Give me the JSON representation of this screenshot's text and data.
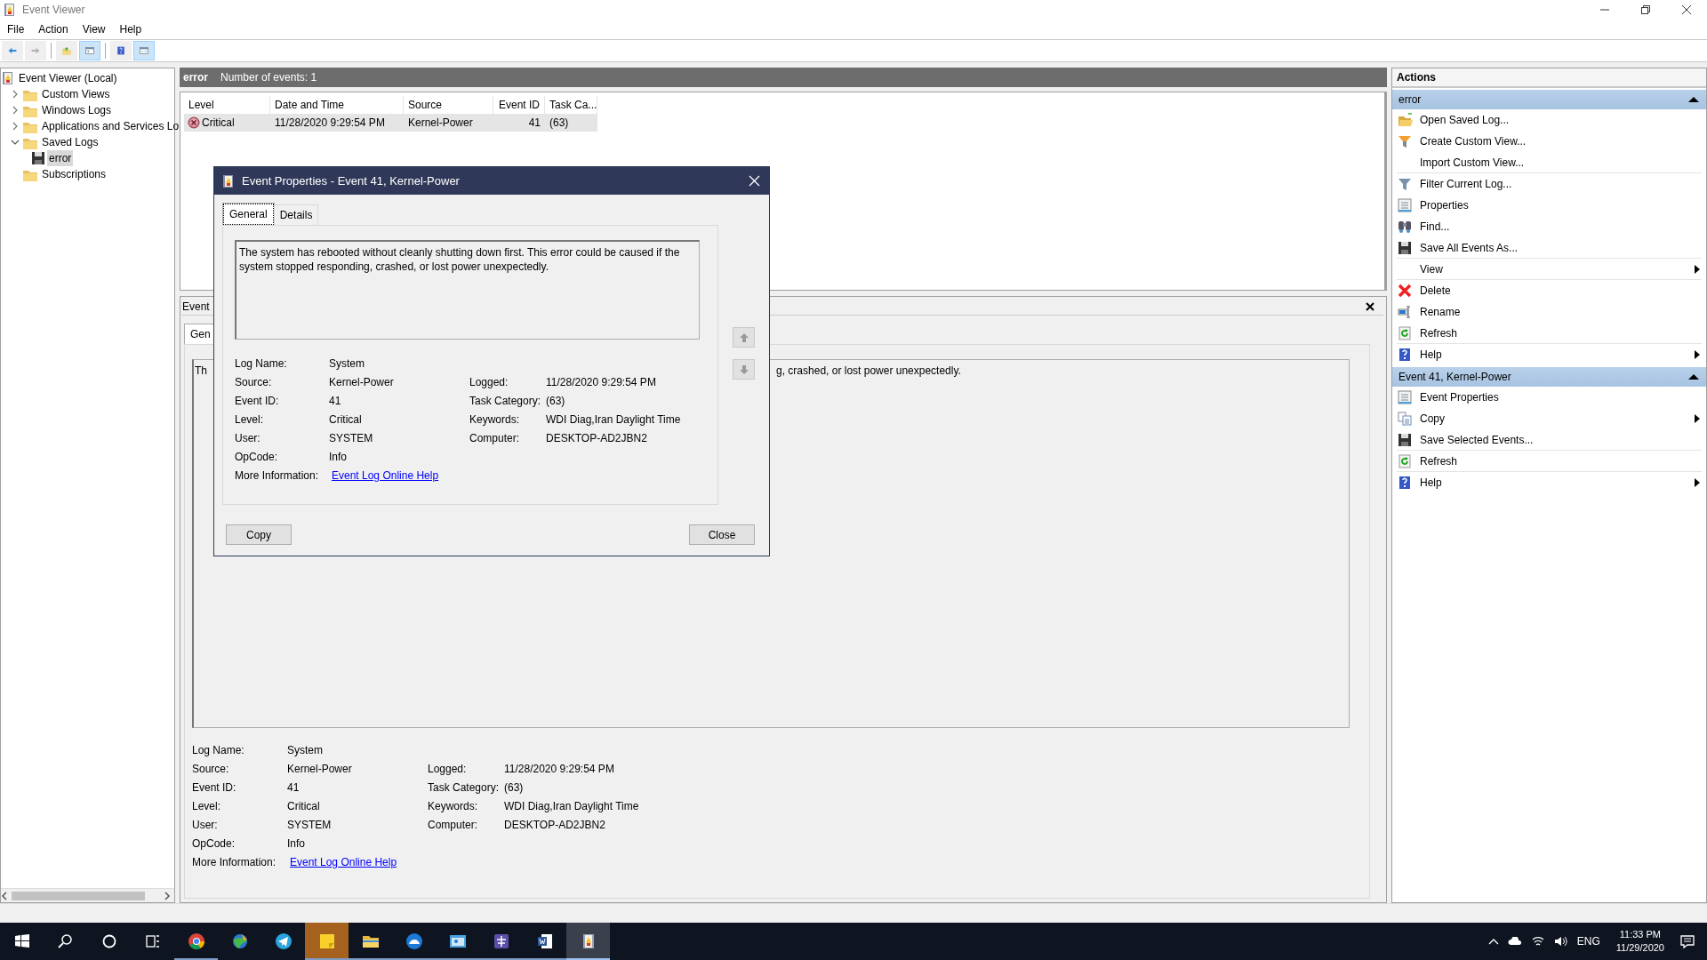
{
  "window": {
    "title": "Event Viewer"
  },
  "menu": [
    "File",
    "Action",
    "View",
    "Help"
  ],
  "toolbar": [
    {
      "kind": "back",
      "pressed": false,
      "disabled": false
    },
    {
      "kind": "forward",
      "pressed": false,
      "disabled": true
    },
    {
      "kind": "up-folder",
      "pressed": false,
      "disabled": false
    },
    {
      "kind": "tree-pane",
      "pressed": true,
      "disabled": false
    },
    {
      "kind": "help",
      "pressed": false,
      "disabled": false
    },
    {
      "kind": "action-pane",
      "pressed": true,
      "disabled": false
    }
  ],
  "tree": [
    {
      "label": "Event Viewer (Local)",
      "kind": "root",
      "selected": false,
      "children": [
        {
          "label": "Custom Views",
          "kind": "folder",
          "expanded": false,
          "selected": false
        },
        {
          "label": "Windows Logs",
          "kind": "folder",
          "expanded": false,
          "selected": false
        },
        {
          "label": "Applications and Services Lo",
          "kind": "folder",
          "expanded": false,
          "selected": false
        },
        {
          "label": "Saved Logs",
          "kind": "folder",
          "expanded": true,
          "selected": false,
          "children": [
            {
              "label": "error",
              "kind": "log",
              "selected": true
            }
          ]
        },
        {
          "label": "Subscriptions",
          "kind": "folder",
          "selected": false
        }
      ]
    }
  ],
  "log_header": {
    "name": "error",
    "count": "Number of events: 1"
  },
  "events": {
    "columns": [
      "Level",
      "Date and Time",
      "Source",
      "Event ID",
      "Task Ca..."
    ],
    "rows": [
      {
        "kind": "critical",
        "level": "Critical",
        "date": "11/28/2020 9:29:54 PM",
        "source": "Kernel-Power",
        "event_id": "41",
        "task_category": "(63)",
        "selected": true
      }
    ]
  },
  "detail_pane": {
    "title": "Event",
    "tabs": [
      {
        "label": "Gen",
        "selected": true
      }
    ],
    "description": [
      "Th",
      "g, crashed, or lost power unexpectedly."
    ],
    "rows": [
      {
        "label": "Log Name:",
        "value": "System"
      },
      {
        "label": "Source:",
        "value": "Kernel-Power",
        "label_2": "Logged:",
        "value_2": "11/28/2020 9:29:54 PM"
      },
      {
        "label": "Event ID:",
        "value": "41",
        "label_2": "Task Category:",
        "value_2": "(63)"
      },
      {
        "label": "Level:",
        "value": "Critical",
        "label_2": "Keywords:",
        "value_2": "WDI Diag,Iran Daylight Time"
      },
      {
        "label": "User:",
        "value": "SYSTEM",
        "label_2": "Computer:",
        "value_2": "DESKTOP-AD2JBN2"
      },
      {
        "label": "OpCode:",
        "value": "Info"
      }
    ],
    "more_information": {
      "label": "More Information:",
      "link": "Event Log Online Help"
    }
  },
  "dialog": {
    "title": "Event Properties - Event 41, Kernel-Power",
    "tabs": [
      {
        "label": "General",
        "selected": true
      },
      {
        "label": "Details",
        "selected": false
      }
    ],
    "description": "The system has rebooted without cleanly shutting down first. This error could be caused if the system stopped responding, crashed, or lost power unexpectedly.",
    "rows": [
      {
        "label": "Log Name:",
        "value": "System"
      },
      {
        "label": "Source:",
        "value": "Kernel-Power",
        "label_2": "Logged:",
        "value_2": "11/28/2020 9:29:54 PM"
      },
      {
        "label": "Event ID:",
        "value": "41",
        "label_2": "Task Category:",
        "value_2": "(63)"
      },
      {
        "label": "Level:",
        "value": "Critical",
        "label_2": "Keywords:",
        "value_2": "WDI Diag,Iran Daylight Time"
      },
      {
        "label": "User:",
        "value": "SYSTEM",
        "label_2": "Computer:",
        "value_2": "DESKTOP-AD2JBN2"
      },
      {
        "label": "OpCode:",
        "value": "Info"
      }
    ],
    "more_information": {
      "label": "More Information:",
      "link": "Event Log Online Help"
    },
    "buttons": [
      "Copy",
      "Close"
    ]
  },
  "actions": {
    "title": "Actions",
    "groups": [
      {
        "title": "error",
        "expanded": true,
        "items": [
          {
            "label": "Open Saved Log...",
            "kind": "open"
          },
          {
            "label": "Create Custom View...",
            "kind": "funnel-color"
          },
          {
            "label": "Import Custom View...",
            "kind": "none",
            "separator_after": true
          },
          {
            "label": "Filter Current Log...",
            "kind": "funnel"
          },
          {
            "label": "Properties",
            "kind": "sheet"
          },
          {
            "label": "Find...",
            "kind": "find"
          },
          {
            "label": "Save All Events As...",
            "kind": "save",
            "separator_after": true
          },
          {
            "label": "View",
            "kind": "none",
            "submenu": true,
            "separator_after": true
          },
          {
            "label": "Delete",
            "kind": "delete"
          },
          {
            "label": "Rename",
            "kind": "rename"
          },
          {
            "label": "Refresh",
            "kind": "refresh",
            "separator_after": true
          },
          {
            "label": "Help",
            "kind": "help",
            "submenu": true
          }
        ]
      },
      {
        "title": "Event 41, Kernel-Power",
        "expanded": true,
        "items": [
          {
            "label": "Event Properties",
            "kind": "sheet"
          },
          {
            "label": "Copy",
            "kind": "copy",
            "submenu": true
          },
          {
            "label": "Save Selected Events...",
            "kind": "save",
            "separator_after": true
          },
          {
            "label": "Refresh",
            "kind": "refresh",
            "separator_after": true
          },
          {
            "label": "Help",
            "kind": "help",
            "submenu": true
          }
        ]
      }
    ]
  },
  "taskbar": {
    "apps": [
      {
        "kind": "start",
        "running": false,
        "attention": false,
        "selected": false
      },
      {
        "kind": "search",
        "running": false,
        "attention": false,
        "selected": false
      },
      {
        "kind": "ring",
        "running": false,
        "attention": false,
        "selected": false
      },
      {
        "kind": "task-view",
        "running": false,
        "attention": false,
        "selected": false
      },
      {
        "kind": "tricolor",
        "running": true,
        "attention": false,
        "selected": false
      },
      {
        "kind": "globe",
        "running": false,
        "attention": false,
        "selected": false
      },
      {
        "kind": "plane",
        "running": false,
        "attention": false,
        "selected": false
      },
      {
        "kind": "note",
        "running": true,
        "attention": true,
        "selected": false
      },
      {
        "kind": "folder",
        "running": true,
        "attention": false,
        "selected": false
      },
      {
        "kind": "blue-circle",
        "running": true,
        "attention": false,
        "selected": false
      },
      {
        "kind": "photo",
        "running": true,
        "attention": false,
        "selected": false
      },
      {
        "kind": "purple",
        "running": true,
        "attention": false,
        "selected": false
      },
      {
        "kind": "document",
        "running": true,
        "attention": false,
        "selected": false
      },
      {
        "kind": "log",
        "running": true,
        "attention": false,
        "selected": true
      }
    ],
    "tray": {
      "language": "ENG",
      "time": "11:33 PM",
      "date": "11/29/2020"
    }
  }
}
